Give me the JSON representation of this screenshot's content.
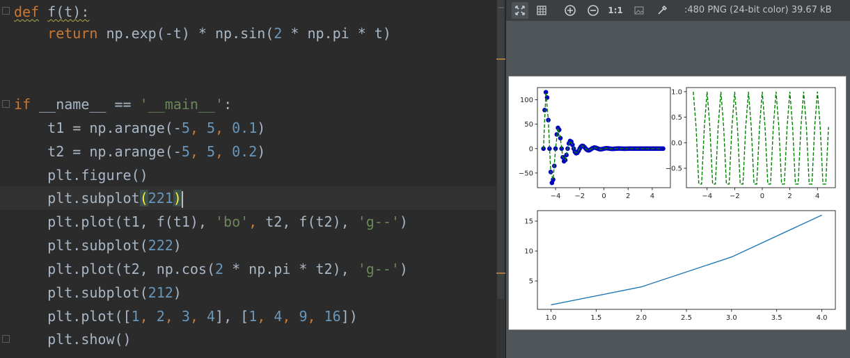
{
  "editor": {
    "lines": [
      {
        "tokens": [
          {
            "t": "def",
            "c": "kw squig"
          },
          {
            "t": " ",
            "c": ""
          },
          {
            "t": "f(t):",
            "c": "squig"
          }
        ]
      },
      {
        "tokens": [
          {
            "t": "    ",
            "c": ""
          },
          {
            "t": "return",
            "c": "kw"
          },
          {
            "t": " np.exp(-t) * np.sin(",
            "c": ""
          },
          {
            "t": "2",
            "c": "num"
          },
          {
            "t": " * np.pi * t)",
            "c": ""
          }
        ]
      },
      {
        "tokens": []
      },
      {
        "tokens": []
      },
      {
        "tokens": [
          {
            "t": "if",
            "c": "kw"
          },
          {
            "t": " __name__ == ",
            "c": ""
          },
          {
            "t": "'__main__'",
            "c": "str"
          },
          {
            "t": ":",
            "c": ""
          }
        ]
      },
      {
        "tokens": [
          {
            "t": "    t1 = np.arange(-",
            "c": ""
          },
          {
            "t": "5",
            "c": "num"
          },
          {
            "t": ", ",
            "c": "kw"
          },
          {
            "t": "5",
            "c": "num"
          },
          {
            "t": ", ",
            "c": "kw"
          },
          {
            "t": "0.1",
            "c": "num"
          },
          {
            "t": ")",
            "c": ""
          }
        ]
      },
      {
        "tokens": [
          {
            "t": "    t2 = np.arange(-",
            "c": ""
          },
          {
            "t": "5",
            "c": "num"
          },
          {
            "t": ", ",
            "c": "kw"
          },
          {
            "t": "5",
            "c": "num"
          },
          {
            "t": ", ",
            "c": "kw"
          },
          {
            "t": "0.2",
            "c": "num"
          },
          {
            "t": ")",
            "c": ""
          }
        ]
      },
      {
        "tokens": [
          {
            "t": "    plt.figure()",
            "c": ""
          }
        ]
      },
      {
        "tokens": [
          {
            "t": "    plt.subplot",
            "c": ""
          },
          {
            "t": "(",
            "c": "bracket-hl"
          },
          {
            "t": "221",
            "c": "num"
          },
          {
            "t": ")",
            "c": "bracket-hl"
          }
        ],
        "current": true
      },
      {
        "tokens": [
          {
            "t": "    plt.plot(t1, f(t1), ",
            "c": ""
          },
          {
            "t": "'bo'",
            "c": "str"
          },
          {
            "t": ", ",
            "c": "kw"
          },
          {
            "t": "t2, f(t2), ",
            "c": ""
          },
          {
            "t": "'g--'",
            "c": "str"
          },
          {
            "t": ")",
            "c": ""
          }
        ]
      },
      {
        "tokens": [
          {
            "t": "    plt.subplot(",
            "c": ""
          },
          {
            "t": "222",
            "c": "num"
          },
          {
            "t": ")",
            "c": ""
          }
        ]
      },
      {
        "tokens": [
          {
            "t": "    plt.plot(t2, np.cos(",
            "c": ""
          },
          {
            "t": "2",
            "c": "num"
          },
          {
            "t": " * np.pi * t2), ",
            "c": ""
          },
          {
            "t": "'g--'",
            "c": "str"
          },
          {
            "t": ")",
            "c": ""
          }
        ]
      },
      {
        "tokens": [
          {
            "t": "    plt.subplot(",
            "c": ""
          },
          {
            "t": "212",
            "c": "num"
          },
          {
            "t": ")",
            "c": ""
          }
        ]
      },
      {
        "tokens": [
          {
            "t": "    plt.plot([",
            "c": ""
          },
          {
            "t": "1",
            "c": "num"
          },
          {
            "t": ", ",
            "c": "kw"
          },
          {
            "t": "2",
            "c": "num"
          },
          {
            "t": ", ",
            "c": "kw"
          },
          {
            "t": "3",
            "c": "num"
          },
          {
            "t": ", ",
            "c": "kw"
          },
          {
            "t": "4",
            "c": "num"
          },
          {
            "t": "], [",
            "c": ""
          },
          {
            "t": "1",
            "c": "num"
          },
          {
            "t": ", ",
            "c": "kw"
          },
          {
            "t": "4",
            "c": "num"
          },
          {
            "t": ", ",
            "c": "kw"
          },
          {
            "t": "9",
            "c": "num"
          },
          {
            "t": ", ",
            "c": "kw"
          },
          {
            "t": "16",
            "c": "num"
          },
          {
            "t": "])",
            "c": ""
          }
        ]
      },
      {
        "tokens": [
          {
            "t": "    plt.show()",
            "c": ""
          }
        ]
      }
    ]
  },
  "viewer": {
    "toolbar": {
      "fit_icon": "fit-screen-icon",
      "grid_icon": "grid-icon",
      "zoom_in_icon": "zoom-in-icon",
      "zoom_out_icon": "zoom-out-icon",
      "actual_size_label": "1:1",
      "background_icon": "background-icon",
      "color_picker_icon": "eyedropper-icon"
    },
    "image_info": ":480 PNG (24-bit color) 39.67 kB"
  },
  "colors": {
    "editor_bg": "#2b2b2b",
    "keyword": "#cc7832",
    "number": "#6897bb",
    "string": "#6a8759",
    "text": "#a9b7c6",
    "plot_blue": "#0000bf",
    "plot_green": "#008000",
    "plot_line": "#1f77b4"
  },
  "chart_data": [
    {
      "type": "line",
      "position": "top-left",
      "series": [
        {
          "style": "bo",
          "color": "#0000bf",
          "x_range": [
            -5,
            5
          ],
          "step": 0.1,
          "function": "exp(-t)*sin(2*pi*t)"
        },
        {
          "style": "g--",
          "color": "#008000",
          "x_range": [
            -5,
            5
          ],
          "step": 0.2,
          "function": "exp(-t)*sin(2*pi*t)"
        }
      ],
      "xticks": [
        "−4",
        "−2",
        "0",
        "2",
        "4"
      ],
      "yticks": [
        "−50",
        "0",
        "50",
        "100"
      ],
      "xlim": [
        -5.5,
        5.5
      ],
      "ylim": [
        -80,
        125
      ]
    },
    {
      "type": "line",
      "position": "top-right",
      "series": [
        {
          "style": "g--",
          "color": "#008000",
          "x_range": [
            -5,
            5
          ],
          "step": 0.2,
          "function": "cos(2*pi*t)"
        }
      ],
      "xticks": [
        "−4",
        "−2",
        "0",
        "2",
        "4"
      ],
      "yticks": [
        "−0.5",
        "0.0",
        "0.5",
        "1.0"
      ],
      "xlim": [
        -5.5,
        5.3
      ],
      "ylim": [
        -0.88,
        1.08
      ]
    },
    {
      "type": "line",
      "position": "bottom",
      "x": [
        1,
        2,
        3,
        4
      ],
      "series": [
        {
          "style": "-",
          "color": "#1f77b4",
          "values": [
            1,
            4,
            9,
            16
          ]
        }
      ],
      "xticks": [
        "1.0",
        "1.5",
        "2.0",
        "2.5",
        "3.0",
        "3.5",
        "4.0"
      ],
      "yticks": [
        "5",
        "10",
        "15"
      ],
      "xlim": [
        0.85,
        4.15
      ],
      "ylim": [
        0.25,
        16.75
      ]
    }
  ]
}
